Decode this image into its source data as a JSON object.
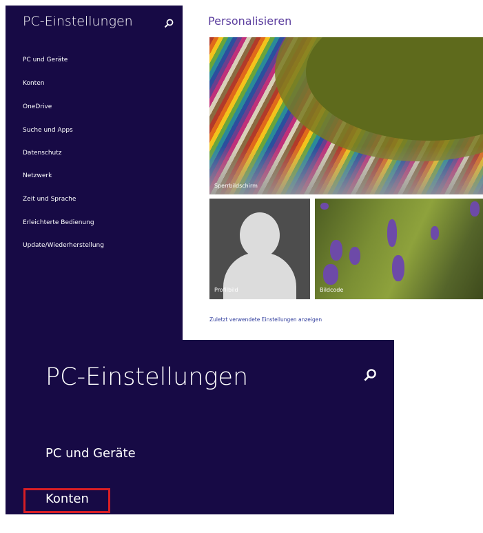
{
  "sidebar": {
    "title": "PC-Einstellungen",
    "search_icon": "search-icon",
    "items": [
      {
        "label": "PC und Geräte"
      },
      {
        "label": "Konten"
      },
      {
        "label": "OneDrive"
      },
      {
        "label": "Suche und Apps"
      },
      {
        "label": "Datenschutz"
      },
      {
        "label": "Netzwerk"
      },
      {
        "label": "Zeit und Sprache"
      },
      {
        "label": "Erleichterte Bedienung"
      },
      {
        "label": "Update/Wiederherstellung"
      }
    ]
  },
  "main": {
    "title": "Personalisieren",
    "tiles": {
      "lockscreen_label": "Sperrbildschirm",
      "profile_label": "Profilbild",
      "picture_password_label": "Bildcode"
    },
    "recent_link": "Zuletzt verwendete Einstellungen anzeigen"
  },
  "zoom": {
    "title": "PC-Einstellungen",
    "item_pc": "PC und Geräte",
    "item_konten": "Konten",
    "highlight_color": "#d81e24"
  },
  "colors": {
    "sidebar_bg": "#170a45",
    "accent_title": "#5b3e9e",
    "link": "#2f3c9c"
  }
}
